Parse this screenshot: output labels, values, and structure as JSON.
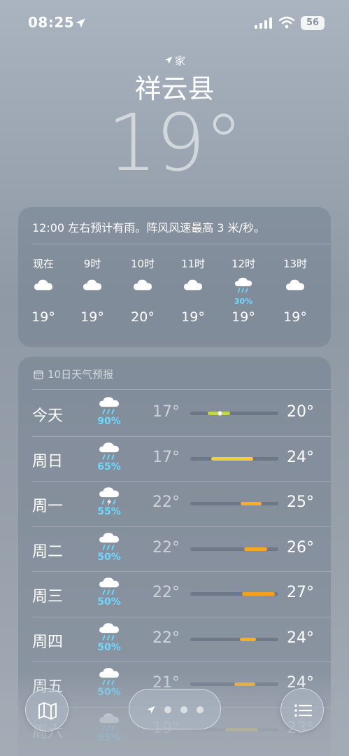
{
  "status_bar": {
    "time": "08:25",
    "battery": "56"
  },
  "location": {
    "label": "家",
    "city": "祥云县",
    "temperature": "19°"
  },
  "hourly": {
    "summary": "12:00 左右预计有雨。阵风风速最高 3 米/秒。",
    "items": [
      {
        "label": "现在",
        "icon": "cloud-icon",
        "precip": "",
        "temp": "19°"
      },
      {
        "label": "9时",
        "icon": "cloud-icon",
        "precip": "",
        "temp": "19°"
      },
      {
        "label": "10时",
        "icon": "cloud-icon",
        "precip": "",
        "temp": "20°"
      },
      {
        "label": "11时",
        "icon": "cloud-icon",
        "precip": "",
        "temp": "19°"
      },
      {
        "label": "12时",
        "icon": "cloud-rain-icon",
        "precip": "30%",
        "temp": "19°"
      },
      {
        "label": "13时",
        "icon": "cloud-icon",
        "precip": "",
        "temp": "19°"
      }
    ]
  },
  "daily": {
    "title": "10日天气预报",
    "items": [
      {
        "day": "今天",
        "icon": "cloud-rain-icon",
        "precip": "90%",
        "low": "17°",
        "high": "20°",
        "range_start": 0.2,
        "range_end": 0.45,
        "current": 0.33,
        "color": "#c5d64a"
      },
      {
        "day": "周日",
        "icon": "cloud-rain-icon",
        "precip": "65%",
        "low": "17°",
        "high": "24°",
        "range_start": 0.24,
        "range_end": 0.72,
        "current": null,
        "color": "#f2cf3a"
      },
      {
        "day": "周一",
        "icon": "cloud-bolt-rain-icon",
        "precip": "55%",
        "low": "22°",
        "high": "25°",
        "range_start": 0.57,
        "range_end": 0.81,
        "current": null,
        "color": "#f5b025"
      },
      {
        "day": "周二",
        "icon": "cloud-rain-icon",
        "precip": "50%",
        "low": "22°",
        "high": "26°",
        "range_start": 0.61,
        "range_end": 0.87,
        "current": null,
        "color": "#f5a623"
      },
      {
        "day": "周三",
        "icon": "cloud-rain-icon",
        "precip": "50%",
        "low": "22°",
        "high": "27°",
        "range_start": 0.59,
        "range_end": 0.96,
        "current": null,
        "color": "#f5a020"
      },
      {
        "day": "周四",
        "icon": "cloud-rain-icon",
        "precip": "50%",
        "low": "22°",
        "high": "24°",
        "range_start": 0.56,
        "range_end": 0.74,
        "current": null,
        "color": "#f5b025"
      },
      {
        "day": "周五",
        "icon": "cloud-rain-icon",
        "precip": "50%",
        "low": "21°",
        "high": "24°",
        "range_start": 0.5,
        "range_end": 0.74,
        "current": null,
        "color": "#f5b025"
      },
      {
        "day": "周六",
        "icon": "cloud-rain-icon",
        "precip": "65%",
        "low": "19°",
        "high": "23°",
        "range_start": 0.4,
        "range_end": 0.77,
        "current": null,
        "color": "#e8c13a"
      }
    ]
  },
  "toolbar": {
    "map_icon": "map-icon",
    "list_icon": "list-icon"
  }
}
